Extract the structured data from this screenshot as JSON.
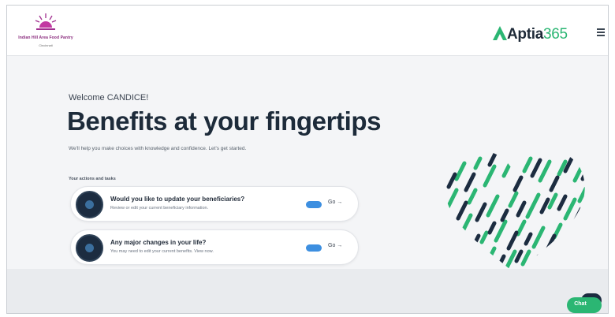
{
  "header": {
    "client_name": "Indian Hill Area Food Pantry",
    "client_subtitle": "Cincinnati",
    "brand_name": "Aptia",
    "brand_number": "365",
    "menu_icon": "hamburger-menu-icon"
  },
  "hero": {
    "welcome": "Welcome CANDICE!",
    "headline": "Benefits at your fingertips",
    "subtext": "We'll help you make choices with knowledge and confidence. Let's get started.",
    "section_label": "Your actions and tasks"
  },
  "actions": [
    {
      "title": "Would you like to update your beneficiaries?",
      "description": "Review or edit your current beneficiary information.",
      "badge": "",
      "go_label": "Go →",
      "icon": "info-icon"
    },
    {
      "title": "Any major changes in your life?",
      "description": "You may need to edit your current benefits. View now.",
      "badge": "",
      "go_label": "Go →",
      "icon": "info-icon"
    }
  ],
  "chat": {
    "label": "Chat"
  },
  "colors": {
    "brand_green": "#2bb673",
    "navy": "#1c2c40",
    "accent_blue": "#3d8fe0"
  }
}
